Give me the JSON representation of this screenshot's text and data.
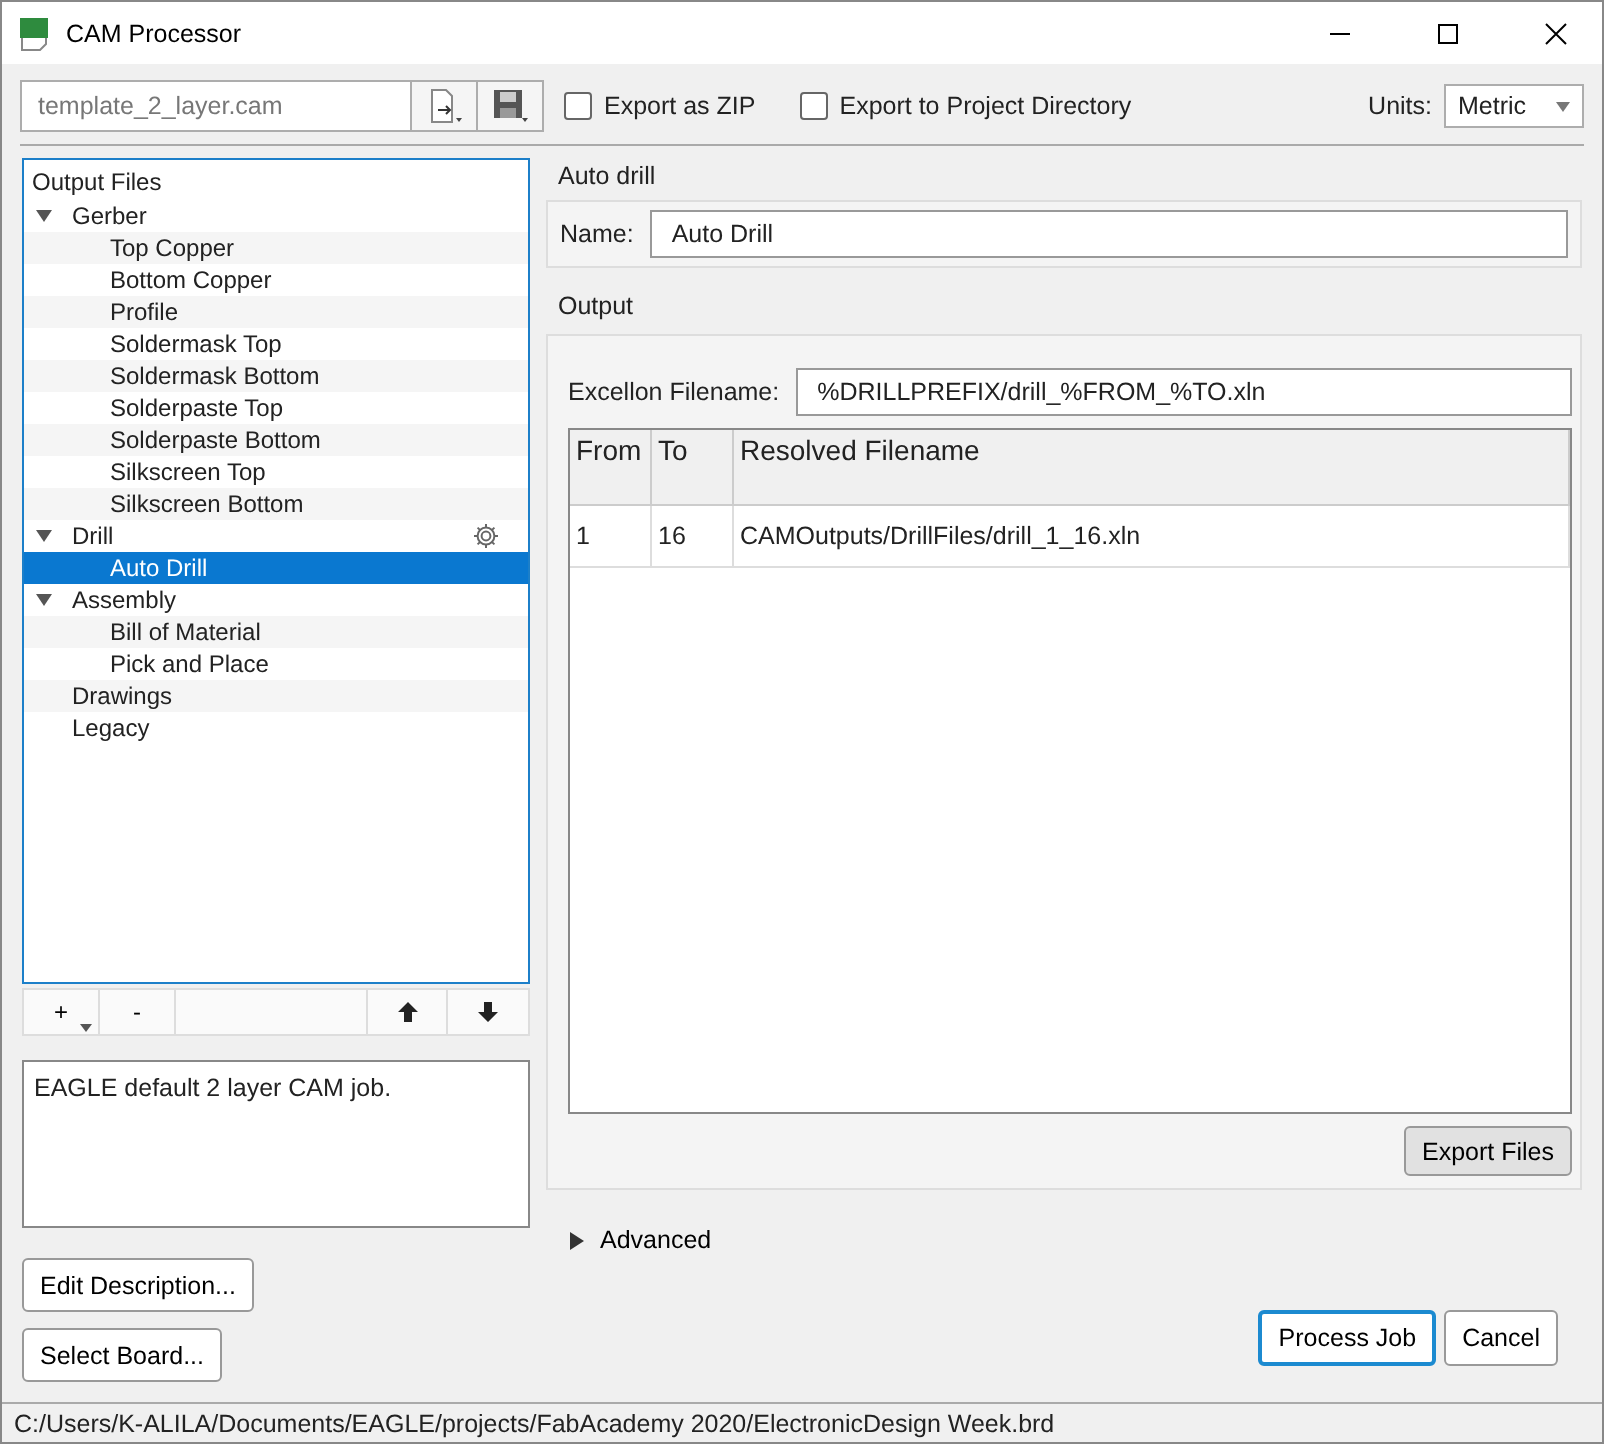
{
  "window": {
    "title": "CAM Processor"
  },
  "toolbar": {
    "job_file": "template_2_layer.cam",
    "checkboxes": [
      {
        "label": "Export as ZIP",
        "checked": false
      },
      {
        "label": "Export to Project Directory",
        "checked": false
      }
    ],
    "units_label": "Units:",
    "units_value": "Metric"
  },
  "output_files": {
    "header": "Output Files",
    "items": [
      {
        "label": "Gerber",
        "expanded": true,
        "selected": false,
        "settings_icon": false,
        "children": [
          {
            "label": "Top Copper",
            "selected": false
          },
          {
            "label": "Bottom Copper",
            "selected": false
          },
          {
            "label": "Profile",
            "selected": false
          },
          {
            "label": "Soldermask Top",
            "selected": false
          },
          {
            "label": "Soldermask Bottom",
            "selected": false
          },
          {
            "label": "Solderpaste Top",
            "selected": false
          },
          {
            "label": "Solderpaste Bottom",
            "selected": false
          },
          {
            "label": "Silkscreen Top",
            "selected": false
          },
          {
            "label": "Silkscreen Bottom",
            "selected": false
          }
        ]
      },
      {
        "label": "Drill",
        "expanded": true,
        "selected": false,
        "settings_icon": true,
        "children": [
          {
            "label": "Auto Drill",
            "selected": true
          }
        ]
      },
      {
        "label": "Assembly",
        "expanded": true,
        "selected": false,
        "settings_icon": false,
        "children": [
          {
            "label": "Bill of Material",
            "selected": false
          },
          {
            "label": "Pick and Place",
            "selected": false
          }
        ]
      },
      {
        "label": "Drawings",
        "selected": false,
        "settings_icon": false
      },
      {
        "label": "Legacy",
        "selected": false,
        "settings_icon": false
      }
    ],
    "buttons": [
      "+",
      "-"
    ]
  },
  "description": "EAGLE default 2 layer CAM job.",
  "left_buttons": [
    "Edit Description...",
    "Select Board..."
  ],
  "detail": {
    "section_title": "Auto drill",
    "name_label": "Name:",
    "name_value": "Auto Drill",
    "output_title": "Output",
    "filename_label": "Excellon Filename:",
    "filename_value": "%DRILLPREFIX/drill_%FROM_%TO.xln",
    "table": {
      "columns": [
        "From",
        "To",
        "Resolved Filename"
      ],
      "rows": [
        [
          "1",
          "16",
          "CAMOutputs/DrillFiles/drill_1_16.xln"
        ]
      ]
    },
    "export_button": "Export Files",
    "advanced": {
      "label": "Advanced",
      "expanded": false
    }
  },
  "actions": [
    {
      "label": "Process Job",
      "selected": true
    },
    {
      "label": "Cancel",
      "selected": false
    }
  ],
  "status_bar": "C:/Users/K-ALILA/Documents/EAGLE/projects/FabAcademy 2020/ElectronicDesign Week.brd"
}
